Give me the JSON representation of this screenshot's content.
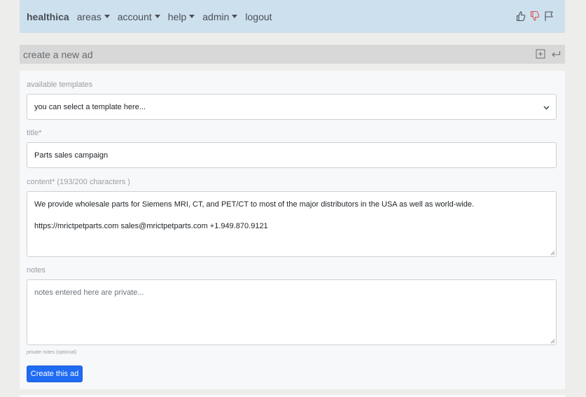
{
  "navbar": {
    "brand": "healthica",
    "menu": [
      {
        "label": "areas",
        "dropdown": true
      },
      {
        "label": "account",
        "dropdown": true
      },
      {
        "label": "help",
        "dropdown": true
      },
      {
        "label": "admin",
        "dropdown": true
      },
      {
        "label": "logout",
        "dropdown": false
      }
    ],
    "icons": [
      "thumbs-up-icon",
      "thumbs-down-icon",
      "flag-icon"
    ]
  },
  "card": {
    "title": "create a new ad",
    "icons": [
      "plus-square-icon",
      "return-arrow-icon"
    ]
  },
  "form": {
    "templates": {
      "label": "available templates",
      "selected": "you can select a template here..."
    },
    "title": {
      "label": "title*",
      "value": "Parts sales campaign"
    },
    "content": {
      "label": "content* (193/200 characters )",
      "line1": "We provide wholesale parts for Siemens MRI, CT, and PET/CT to most of the major distributors in the USA as well as world-wide.",
      "line2": "https://mrictpetparts.com sales@mrictpetparts.com +1.949.870.9121"
    },
    "notes": {
      "label": "notes",
      "placeholder": "notes entered here are private...",
      "help": "private notes (optional)"
    },
    "submit_label": "Create this ad"
  },
  "colors": {
    "navbar_bg": "#cde0ee",
    "primary": "#1f6bf3",
    "thumbs_down": "#d9534f"
  }
}
